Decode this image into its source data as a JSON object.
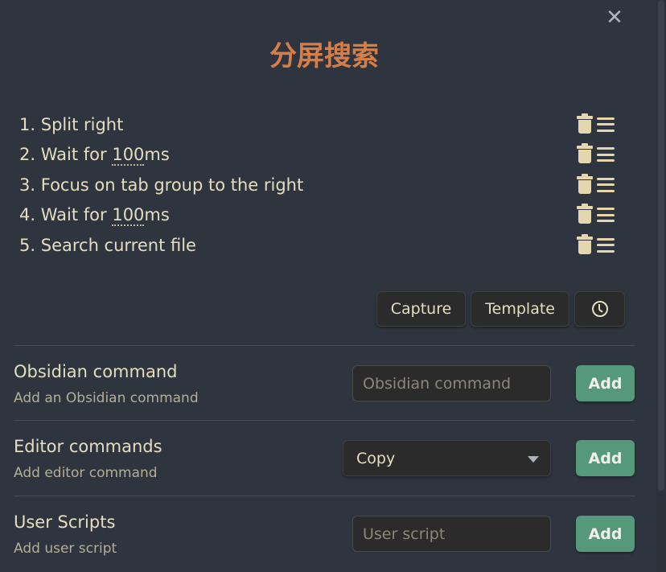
{
  "modal": {
    "title": "分屏搜索",
    "close_label": "✕"
  },
  "commands": [
    {
      "number": "1.",
      "pre": "Split right",
      "dotted": "",
      "post": ""
    },
    {
      "number": "2.",
      "pre": "Wait for ",
      "dotted": "100",
      "post": "ms"
    },
    {
      "number": "3.",
      "pre": "Focus on tab group to the right",
      "dotted": "",
      "post": ""
    },
    {
      "number": "4.",
      "pre": "Wait for ",
      "dotted": "100",
      "post": "ms"
    },
    {
      "number": "5.",
      "pre": "Search current file",
      "dotted": "",
      "post": ""
    }
  ],
  "toolbar": {
    "capture_label": "Capture",
    "template_label": "Template",
    "history_icon": "clock-icon"
  },
  "settings": {
    "obsidian": {
      "name": "Obsidian command",
      "desc": "Add an Obsidian command",
      "placeholder": "Obsidian command",
      "add_label": "Add"
    },
    "editor": {
      "name": "Editor commands",
      "desc": "Add editor command",
      "selected": "Copy",
      "add_label": "Add"
    },
    "scripts": {
      "name": "User Scripts",
      "desc": "Add user script",
      "placeholder": "User script",
      "add_label": "Add"
    }
  },
  "colors": {
    "accent": "#d77d47",
    "add_button": "#56997a",
    "background": "#2f353f"
  }
}
